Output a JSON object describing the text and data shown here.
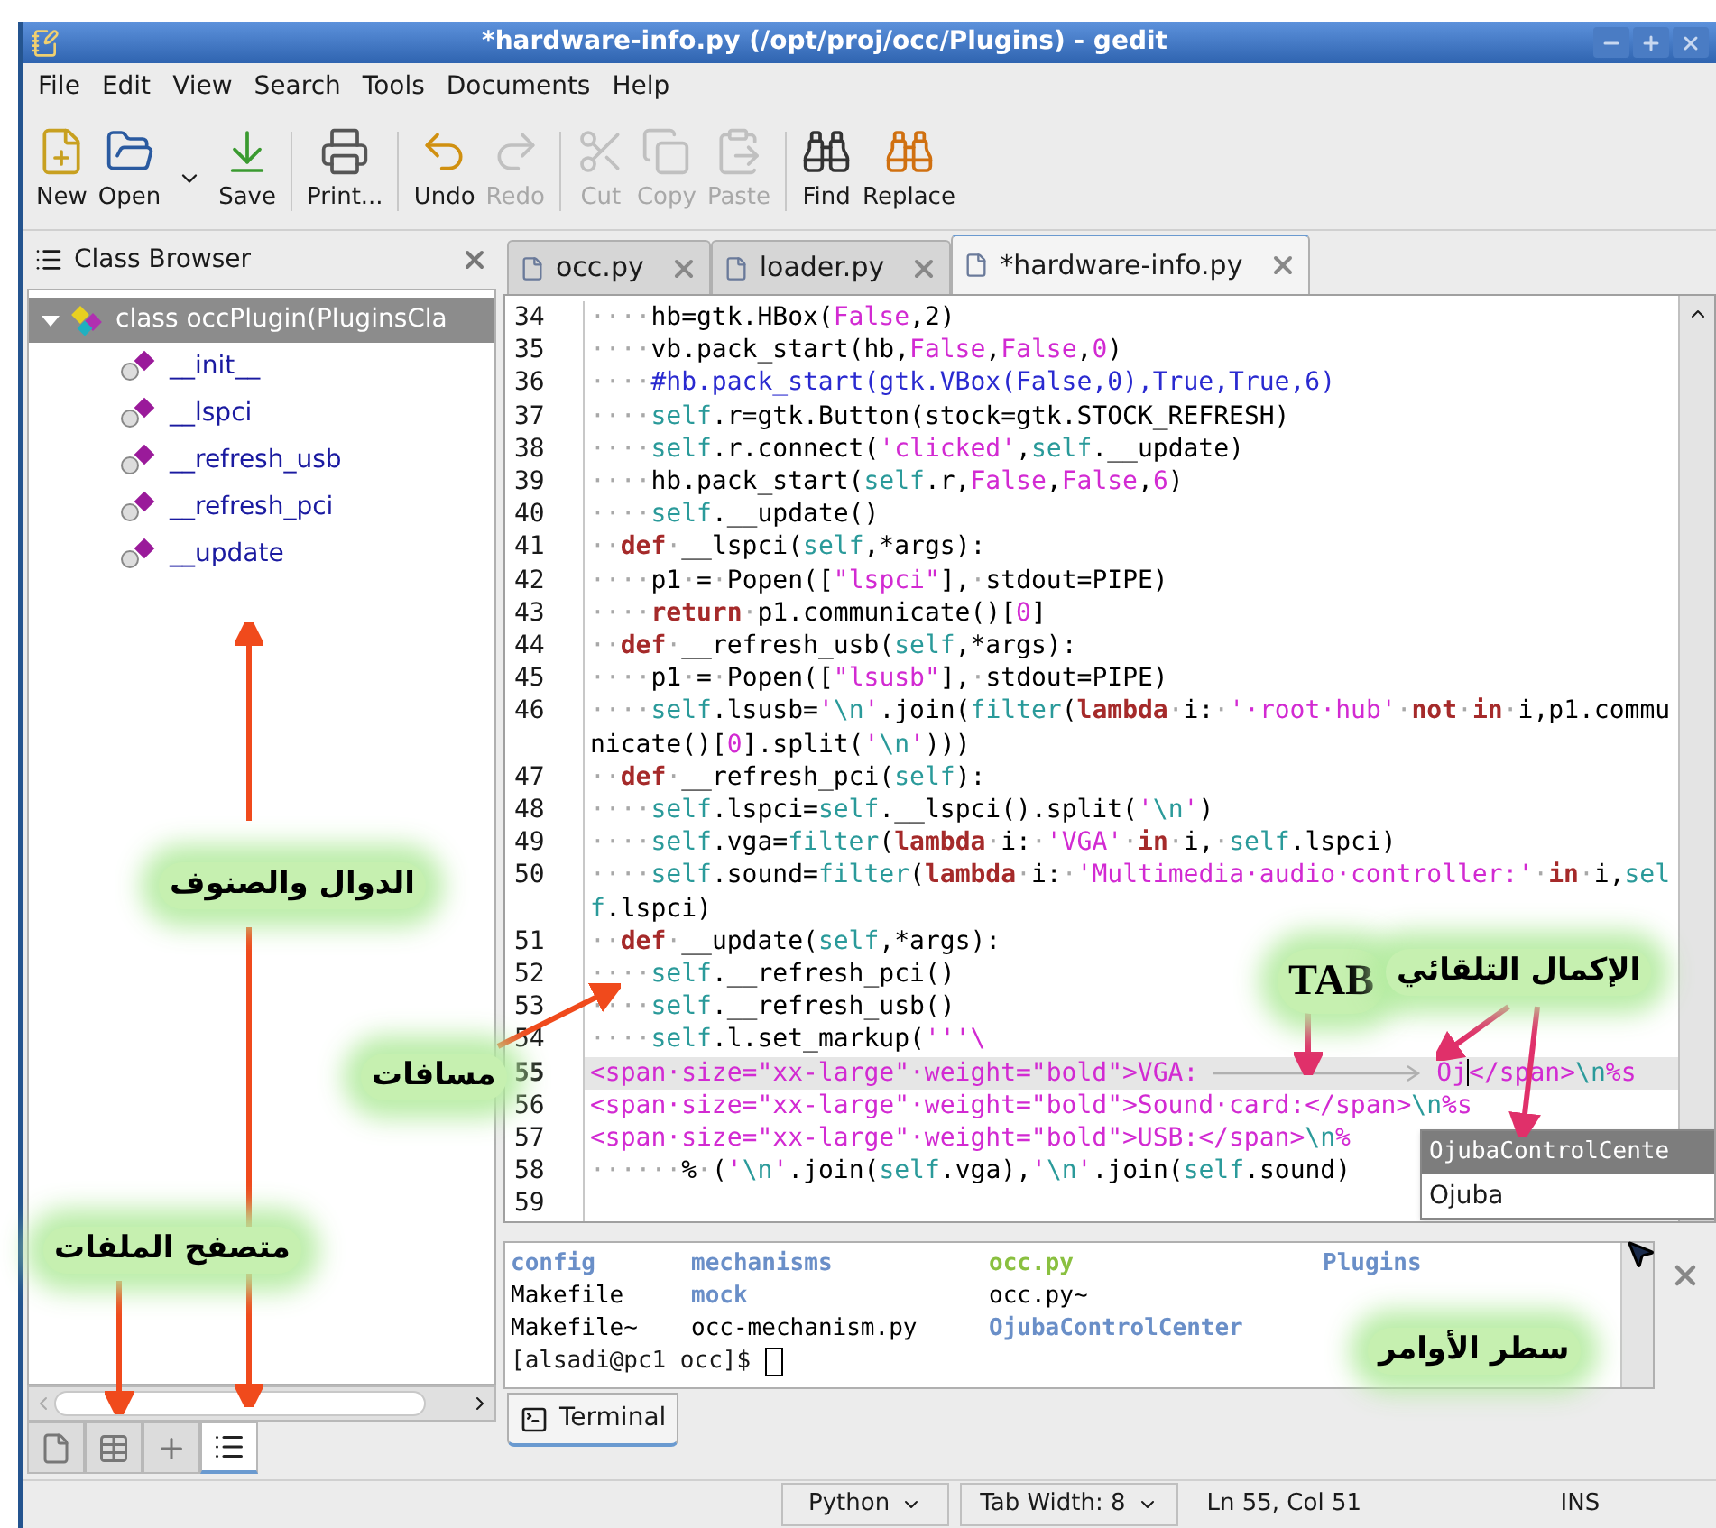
{
  "window": {
    "title": "*hardware-info.py (/opt/proj/occ/Plugins) - gedit"
  },
  "menu": [
    "File",
    "Edit",
    "View",
    "Search",
    "Tools",
    "Documents",
    "Help"
  ],
  "toolbar": [
    {
      "kind": "button",
      "label": "New",
      "disabled": false
    },
    {
      "kind": "button",
      "label": "Open",
      "disabled": false
    },
    {
      "kind": "dropdown"
    },
    {
      "kind": "button",
      "label": "Save",
      "disabled": false
    },
    {
      "kind": "separator"
    },
    {
      "kind": "button",
      "label": "Print...",
      "disabled": false
    },
    {
      "kind": "separator"
    },
    {
      "kind": "button",
      "label": "Undo",
      "disabled": false
    },
    {
      "kind": "button",
      "label": "Redo",
      "disabled": true
    },
    {
      "kind": "separator"
    },
    {
      "kind": "button",
      "label": "Cut",
      "disabled": true
    },
    {
      "kind": "button",
      "label": "Copy",
      "disabled": true
    },
    {
      "kind": "button",
      "label": "Paste",
      "disabled": true
    },
    {
      "kind": "separator"
    },
    {
      "kind": "button",
      "label": "Find",
      "disabled": false
    },
    {
      "kind": "button",
      "label": "Replace",
      "disabled": false
    }
  ],
  "side_panel": {
    "title": "Class Browser",
    "tree": [
      {
        "label": "class occPlugin(PluginsCla",
        "expanded": true,
        "selected": true,
        "children": [
          {
            "label": "__init__",
            "selected": false
          },
          {
            "label": "__lspci",
            "selected": false
          },
          {
            "label": "__refresh_usb",
            "selected": false
          },
          {
            "label": "__refresh_pci",
            "selected": false
          },
          {
            "label": "__update",
            "selected": false
          }
        ]
      }
    ],
    "tabs": [
      {
        "selected": false
      },
      {
        "selected": false
      },
      {
        "selected": false
      },
      {
        "selected": true
      }
    ]
  },
  "editor_tabs": [
    {
      "label": "occ.py",
      "selected": false
    },
    {
      "label": "loader.py",
      "selected": false
    },
    {
      "label": "*hardware-info.py",
      "selected": true
    }
  ],
  "code": {
    "lines": [
      {
        "number": "34",
        "current": false,
        "tokens": [
          {
            "kind": "ws",
            "text": "····"
          },
          {
            "kind": "p",
            "text": "hb=gtk.HBox("
          },
          {
            "kind": "num",
            "text": "False"
          },
          {
            "kind": "p",
            "text": ",2)"
          }
        ]
      },
      {
        "number": "35",
        "current": false,
        "tokens": [
          {
            "kind": "ws",
            "text": "····"
          },
          {
            "kind": "p",
            "text": "vb.pack_start(hb,"
          },
          {
            "kind": "num",
            "text": "False"
          },
          {
            "kind": "p",
            "text": ","
          },
          {
            "kind": "num",
            "text": "False"
          },
          {
            "kind": "p",
            "text": ","
          },
          {
            "kind": "num",
            "text": "0"
          },
          {
            "kind": "p",
            "text": ")"
          }
        ]
      },
      {
        "number": "36",
        "current": false,
        "tokens": [
          {
            "kind": "ws",
            "text": "····"
          },
          {
            "kind": "com",
            "text": "#hb.pack_start(gtk.VBox(False,0),True,True,6)"
          }
        ]
      },
      {
        "number": "37",
        "current": false,
        "tokens": [
          {
            "kind": "ws",
            "text": "····"
          },
          {
            "kind": "self",
            "text": "self"
          },
          {
            "kind": "p",
            "text": ".r=gtk.Button(stock=gtk.STOCK_REFRESH)"
          }
        ]
      },
      {
        "number": "38",
        "current": false,
        "tokens": [
          {
            "kind": "ws",
            "text": "····"
          },
          {
            "kind": "self",
            "text": "self"
          },
          {
            "kind": "p",
            "text": ".r.connect("
          },
          {
            "kind": "str",
            "text": "'clicked'"
          },
          {
            "kind": "p",
            "text": ","
          },
          {
            "kind": "self",
            "text": "self"
          },
          {
            "kind": "p",
            "text": ".__update)"
          }
        ]
      },
      {
        "number": "39",
        "current": false,
        "tokens": [
          {
            "kind": "ws",
            "text": "····"
          },
          {
            "kind": "p",
            "text": "hb.pack_start("
          },
          {
            "kind": "self",
            "text": "self"
          },
          {
            "kind": "p",
            "text": ".r,"
          },
          {
            "kind": "num",
            "text": "False"
          },
          {
            "kind": "p",
            "text": ","
          },
          {
            "kind": "num",
            "text": "False"
          },
          {
            "kind": "p",
            "text": ","
          },
          {
            "kind": "num",
            "text": "6"
          },
          {
            "kind": "p",
            "text": ")"
          }
        ]
      },
      {
        "number": "40",
        "current": false,
        "tokens": [
          {
            "kind": "ws",
            "text": "····"
          },
          {
            "kind": "self",
            "text": "self"
          },
          {
            "kind": "p",
            "text": ".__update()"
          }
        ]
      },
      {
        "number": "41",
        "current": false,
        "tokens": [
          {
            "kind": "ws",
            "text": "··"
          },
          {
            "kind": "kw",
            "text": "def"
          },
          {
            "kind": "ws",
            "text": "·"
          },
          {
            "kind": "p",
            "text": "__lspci("
          },
          {
            "kind": "self",
            "text": "self"
          },
          {
            "kind": "p",
            "text": ",*args):"
          }
        ]
      },
      {
        "number": "42",
        "current": false,
        "tokens": [
          {
            "kind": "ws",
            "text": "····"
          },
          {
            "kind": "p",
            "text": "p1"
          },
          {
            "kind": "ws",
            "text": "·"
          },
          {
            "kind": "p",
            "text": "="
          },
          {
            "kind": "ws",
            "text": "·"
          },
          {
            "kind": "p",
            "text": "Popen(["
          },
          {
            "kind": "str",
            "text": "\"lspci\""
          },
          {
            "kind": "p",
            "text": "],"
          },
          {
            "kind": "ws",
            "text": "·"
          },
          {
            "kind": "p",
            "text": "stdout=PIPE)"
          }
        ]
      },
      {
        "number": "43",
        "current": false,
        "tokens": [
          {
            "kind": "ws",
            "text": "····"
          },
          {
            "kind": "kw",
            "text": "return"
          },
          {
            "kind": "ws",
            "text": "·"
          },
          {
            "kind": "p",
            "text": "p1.communicate()["
          },
          {
            "kind": "num",
            "text": "0"
          },
          {
            "kind": "p",
            "text": "]"
          }
        ]
      },
      {
        "number": "44",
        "current": false,
        "tokens": [
          {
            "kind": "ws",
            "text": "··"
          },
          {
            "kind": "kw",
            "text": "def"
          },
          {
            "kind": "ws",
            "text": "·"
          },
          {
            "kind": "p",
            "text": "__refresh_usb("
          },
          {
            "kind": "self",
            "text": "self"
          },
          {
            "kind": "p",
            "text": ",*args):"
          }
        ]
      },
      {
        "number": "45",
        "current": false,
        "tokens": [
          {
            "kind": "ws",
            "text": "····"
          },
          {
            "kind": "p",
            "text": "p1"
          },
          {
            "kind": "ws",
            "text": "·"
          },
          {
            "kind": "p",
            "text": "="
          },
          {
            "kind": "ws",
            "text": "·"
          },
          {
            "kind": "p",
            "text": "Popen(["
          },
          {
            "kind": "str",
            "text": "\"lsusb\""
          },
          {
            "kind": "p",
            "text": "],"
          },
          {
            "kind": "ws",
            "text": "·"
          },
          {
            "kind": "p",
            "text": "stdout=PIPE)"
          }
        ]
      },
      {
        "number": "46",
        "current": false,
        "tokens": [
          {
            "kind": "ws",
            "text": "····"
          },
          {
            "kind": "self",
            "text": "self"
          },
          {
            "kind": "p",
            "text": ".lsusb="
          },
          {
            "kind": "str",
            "text": "'"
          },
          {
            "kind": "esc",
            "text": "\\n"
          },
          {
            "kind": "str",
            "text": "'"
          },
          {
            "kind": "p",
            "text": ".join("
          },
          {
            "kind": "self",
            "text": "filter"
          },
          {
            "kind": "p",
            "text": "("
          },
          {
            "kind": "kw",
            "text": "lambda"
          },
          {
            "kind": "ws",
            "text": "·"
          },
          {
            "kind": "p",
            "text": "i:"
          },
          {
            "kind": "ws",
            "text": "·"
          },
          {
            "kind": "str",
            "text": "'·root·hub'"
          },
          {
            "kind": "ws",
            "text": "·"
          },
          {
            "kind": "kw",
            "text": "not"
          },
          {
            "kind": "ws",
            "text": "·"
          },
          {
            "kind": "kw",
            "text": "in"
          },
          {
            "kind": "ws",
            "text": "·"
          },
          {
            "kind": "p",
            "text": "i,p1.communicate()["
          },
          {
            "kind": "num",
            "text": "0"
          },
          {
            "kind": "p",
            "text": "].split("
          },
          {
            "kind": "str",
            "text": "'"
          },
          {
            "kind": "esc",
            "text": "\\n"
          },
          {
            "kind": "str",
            "text": "'"
          },
          {
            "kind": "p",
            "text": ")))"
          }
        ]
      },
      {
        "number": "47",
        "current": false,
        "tokens": [
          {
            "kind": "ws",
            "text": "··"
          },
          {
            "kind": "kw",
            "text": "def"
          },
          {
            "kind": "ws",
            "text": "·"
          },
          {
            "kind": "p",
            "text": "__refresh_pci("
          },
          {
            "kind": "self",
            "text": "self"
          },
          {
            "kind": "p",
            "text": "):"
          }
        ]
      },
      {
        "number": "48",
        "current": false,
        "tokens": [
          {
            "kind": "ws",
            "text": "····"
          },
          {
            "kind": "self",
            "text": "self"
          },
          {
            "kind": "p",
            "text": ".lspci="
          },
          {
            "kind": "self",
            "text": "self"
          },
          {
            "kind": "p",
            "text": ".__lspci().split("
          },
          {
            "kind": "str",
            "text": "'"
          },
          {
            "kind": "esc",
            "text": "\\n"
          },
          {
            "kind": "str",
            "text": "'"
          },
          {
            "kind": "p",
            "text": ")"
          }
        ]
      },
      {
        "number": "49",
        "current": false,
        "tokens": [
          {
            "kind": "ws",
            "text": "····"
          },
          {
            "kind": "self",
            "text": "self"
          },
          {
            "kind": "p",
            "text": ".vga="
          },
          {
            "kind": "self",
            "text": "filter"
          },
          {
            "kind": "p",
            "text": "("
          },
          {
            "kind": "kw",
            "text": "lambda"
          },
          {
            "kind": "ws",
            "text": "·"
          },
          {
            "kind": "p",
            "text": "i:"
          },
          {
            "kind": "ws",
            "text": "·"
          },
          {
            "kind": "str",
            "text": "'VGA'"
          },
          {
            "kind": "ws",
            "text": "·"
          },
          {
            "kind": "kw",
            "text": "in"
          },
          {
            "kind": "ws",
            "text": "·"
          },
          {
            "kind": "p",
            "text": "i,"
          },
          {
            "kind": "ws",
            "text": "·"
          },
          {
            "kind": "self",
            "text": "self"
          },
          {
            "kind": "p",
            "text": ".lspci)"
          }
        ]
      },
      {
        "number": "50",
        "current": false,
        "tokens": [
          {
            "kind": "ws",
            "text": "····"
          },
          {
            "kind": "self",
            "text": "self"
          },
          {
            "kind": "p",
            "text": ".sound="
          },
          {
            "kind": "self",
            "text": "filter"
          },
          {
            "kind": "p",
            "text": "("
          },
          {
            "kind": "kw",
            "text": "lambda"
          },
          {
            "kind": "ws",
            "text": "·"
          },
          {
            "kind": "p",
            "text": "i:"
          },
          {
            "kind": "ws",
            "text": "·"
          },
          {
            "kind": "str",
            "text": "'Multimedia·audio·controller:'"
          },
          {
            "kind": "ws",
            "text": "·"
          },
          {
            "kind": "kw",
            "text": "in"
          },
          {
            "kind": "ws",
            "text": "·"
          },
          {
            "kind": "p",
            "text": "i,"
          },
          {
            "kind": "self",
            "text": "self"
          },
          {
            "kind": "p",
            "text": ".lspci)"
          }
        ]
      },
      {
        "number": "51",
        "current": false,
        "tokens": [
          {
            "kind": "ws",
            "text": "··"
          },
          {
            "kind": "kw",
            "text": "def"
          },
          {
            "kind": "ws",
            "text": "·"
          },
          {
            "kind": "p",
            "text": "__update("
          },
          {
            "kind": "self",
            "text": "self"
          },
          {
            "kind": "p",
            "text": ",*args):"
          }
        ]
      },
      {
        "number": "52",
        "current": false,
        "tokens": [
          {
            "kind": "ws",
            "text": "····"
          },
          {
            "kind": "self",
            "text": "self"
          },
          {
            "kind": "p",
            "text": ".__refresh_pci()"
          }
        ]
      },
      {
        "number": "53",
        "current": false,
        "tokens": [
          {
            "kind": "ws",
            "text": "····"
          },
          {
            "kind": "self",
            "text": "self"
          },
          {
            "kind": "p",
            "text": ".__refresh_usb()"
          }
        ]
      },
      {
        "number": "54",
        "current": false,
        "tokens": [
          {
            "kind": "ws",
            "text": "····"
          },
          {
            "kind": "self",
            "text": "self"
          },
          {
            "kind": "p",
            "text": ".l.set_markup("
          },
          {
            "kind": "str",
            "text": "'''\\"
          }
        ]
      },
      {
        "number": "55",
        "current": true,
        "tokens": [
          {
            "kind": "str",
            "text": "<span·size=\"xx-large\"·weight=\"bold\">VGA:"
          },
          {
            "kind": "tab"
          },
          {
            "kind": "str",
            "text": "Oj"
          },
          {
            "kind": "caret"
          },
          {
            "kind": "str",
            "text": "</span>"
          },
          {
            "kind": "esc",
            "text": "\\n"
          },
          {
            "kind": "str",
            "text": "%s"
          }
        ]
      },
      {
        "number": "56",
        "current": false,
        "tokens": [
          {
            "kind": "str",
            "text": "<span·size=\"xx-large\"·weight=\"bold\">Sound·card:</span>"
          },
          {
            "kind": "esc",
            "text": "\\n"
          },
          {
            "kind": "str",
            "text": "%s"
          }
        ]
      },
      {
        "number": "57",
        "current": false,
        "tokens": [
          {
            "kind": "str",
            "text": "<span·size=\"xx-large\"·weight=\"bold\">USB:</span>"
          },
          {
            "kind": "esc",
            "text": "\\n"
          },
          {
            "kind": "str",
            "text": "%"
          }
        ]
      },
      {
        "number": "58",
        "current": false,
        "tokens": [
          {
            "kind": "ws",
            "text": "······"
          },
          {
            "kind": "p",
            "text": "%"
          },
          {
            "kind": "ws",
            "text": "·"
          },
          {
            "kind": "p",
            "text": "("
          },
          {
            "kind": "str",
            "text": "'"
          },
          {
            "kind": "esc",
            "text": "\\n"
          },
          {
            "kind": "str",
            "text": "'"
          },
          {
            "kind": "p",
            "text": ".join("
          },
          {
            "kind": "self",
            "text": "self"
          },
          {
            "kind": "p",
            "text": ".vga),"
          },
          {
            "kind": "str",
            "text": "'"
          },
          {
            "kind": "esc",
            "text": "\\n"
          },
          {
            "kind": "str",
            "text": "'"
          },
          {
            "kind": "p",
            "text": ".join("
          },
          {
            "kind": "self",
            "text": "self"
          },
          {
            "kind": "p",
            "text": ".sound)"
          }
        ]
      },
      {
        "number": "59",
        "current": false
      }
    ]
  },
  "autocomplete": [
    {
      "label": "OjubaControlCente",
      "selected": true
    },
    {
      "label": "Ojuba",
      "selected": false
    }
  ],
  "terminal": {
    "rows": [
      [
        {
          "kind": "dir",
          "text": "config"
        },
        {
          "kind": "dir",
          "text": "mechanisms"
        },
        {
          "kind": "exec",
          "text": "occ.py"
        },
        {
          "kind": "dir",
          "text": "Plugins"
        }
      ],
      [
        {
          "kind": "file",
          "text": "Makefile"
        },
        {
          "kind": "dir",
          "text": "mock"
        },
        {
          "kind": "file",
          "text": "occ.py~"
        }
      ],
      [
        {
          "kind": "file",
          "text": "Makefile~"
        },
        {
          "kind": "file",
          "text": "occ-mechanism.py"
        },
        {
          "kind": "dir",
          "text": "OjubaControlCenter"
        }
      ]
    ],
    "prompt": "[alsadi@pc1 occ]$"
  },
  "bottom_tabs": [
    {
      "label": "Terminal",
      "selected": true
    }
  ],
  "status_bar": {
    "language": "Python",
    "tab_width": "Tab Width: 8",
    "position": "Ln 55, Col 51",
    "mode": "INS"
  },
  "annotations": [
    {
      "text": "الدوال والصنوف"
    },
    {
      "text": "مسافات"
    },
    {
      "text": "متصفح الملفات"
    },
    {
      "text": "TAB"
    },
    {
      "text": "الإكمال التلقائي"
    },
    {
      "text": "سطر الأوامر"
    }
  ]
}
